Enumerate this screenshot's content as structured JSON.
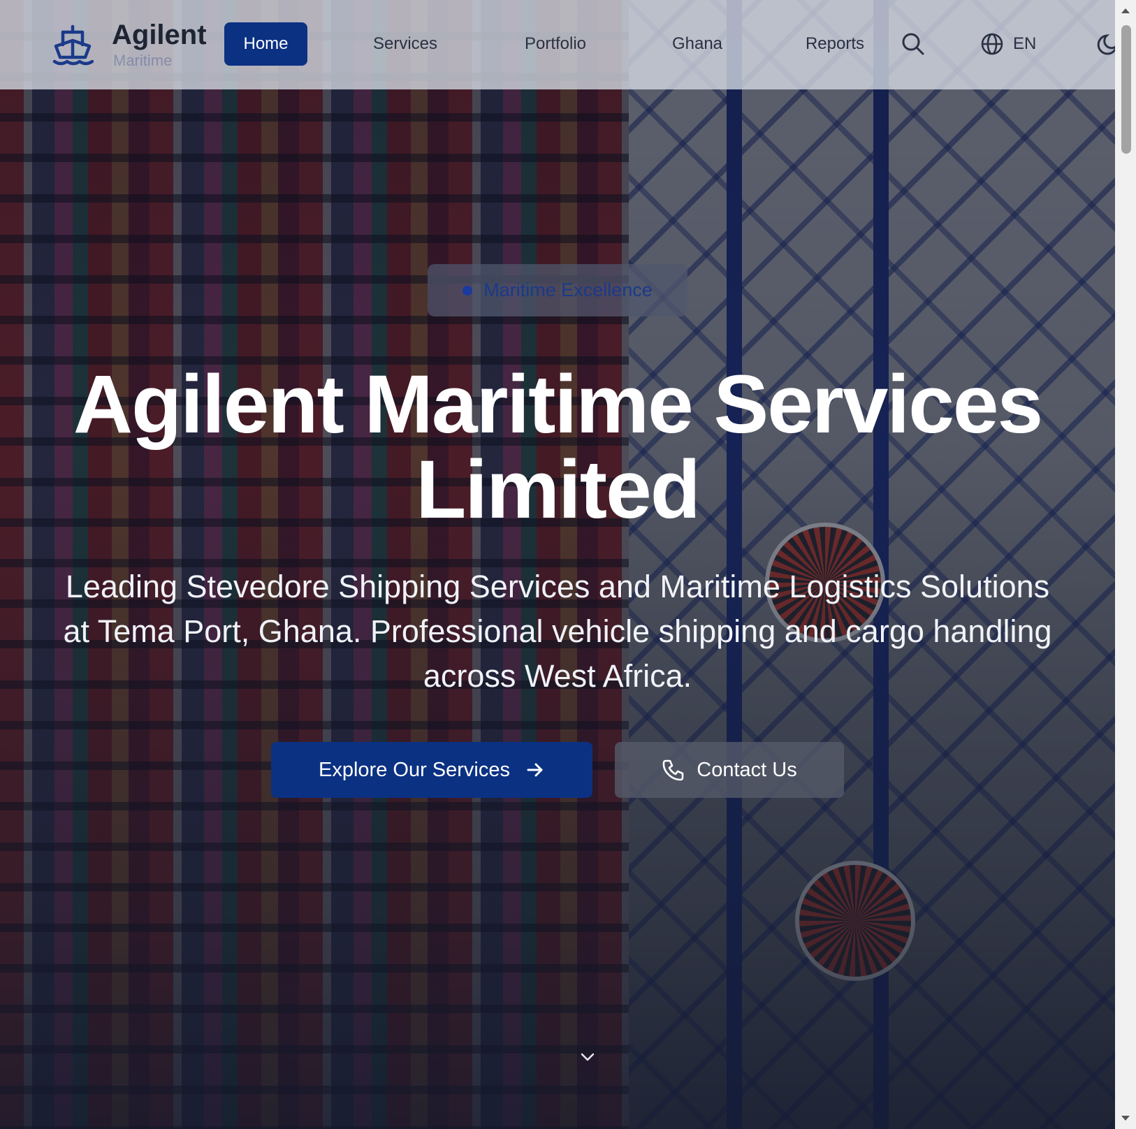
{
  "brand": {
    "name": "Agilent",
    "tagline": "Maritime",
    "icon": "ship-icon",
    "color": "#0b3183"
  },
  "nav": {
    "items": [
      {
        "label": "Home",
        "active": true
      },
      {
        "label": "Services",
        "active": false
      },
      {
        "label": "Portfolio",
        "active": false
      },
      {
        "label": "Ghana",
        "active": false
      },
      {
        "label": "Reports",
        "active": false
      }
    ],
    "search_icon": "search-icon",
    "language": {
      "label": "EN",
      "icon": "globe-icon"
    },
    "theme_icon": "moon-icon"
  },
  "hero": {
    "badge": "Maritime Excellence",
    "title_line1": "Agilent Maritime Services",
    "title_line2": "Limited",
    "description": "Leading Stevedore Shipping Services and Maritime Logistics Solutions at Tema Port, Ghana. Professional vehicle shipping and cargo handling across West Africa.",
    "primary_button": {
      "label": "Explore Our Services",
      "icon": "arrow-right-icon"
    },
    "secondary_button": {
      "label": "Contact Us",
      "icon": "phone-icon"
    },
    "scroll_icon": "chevron-down-icon"
  },
  "colors": {
    "accent": "#0b3183",
    "header_bg": "#d7dce6",
    "text_light": "#ffffff"
  }
}
